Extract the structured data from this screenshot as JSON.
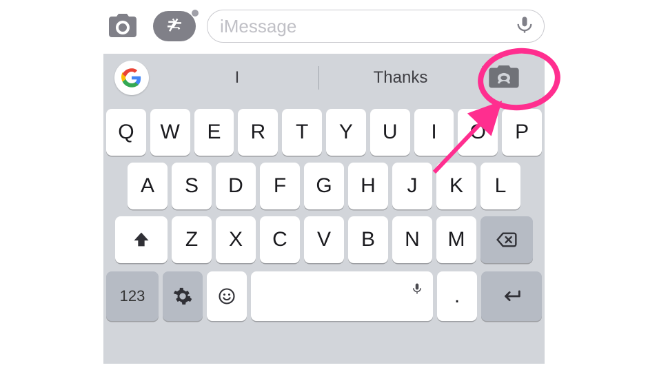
{
  "input": {
    "placeholder": "iMessage"
  },
  "suggestions": {
    "s1": "I",
    "s2": "Thanks"
  },
  "keys": {
    "r1": [
      "Q",
      "W",
      "E",
      "R",
      "T",
      "Y",
      "U",
      "I",
      "O",
      "P"
    ],
    "r2": [
      "A",
      "S",
      "D",
      "F",
      "G",
      "H",
      "J",
      "K",
      "L"
    ],
    "r3": [
      "Z",
      "X",
      "C",
      "V",
      "B",
      "N",
      "M"
    ],
    "num": "123",
    "period": "."
  },
  "icons": {
    "camera": "camera-icon",
    "appstore": "appstore-icon",
    "mic": "microphone-icon",
    "google": "google-logo",
    "gif": "gif-camera-icon",
    "shift": "shift-icon",
    "backspace": "backspace-icon",
    "gear": "gear-icon",
    "emoji": "emoji-icon",
    "enter": "return-icon",
    "space_mic": "mic-small-icon"
  },
  "annotation": {
    "target": "gif-camera-button",
    "color": "#ff2e8f"
  }
}
